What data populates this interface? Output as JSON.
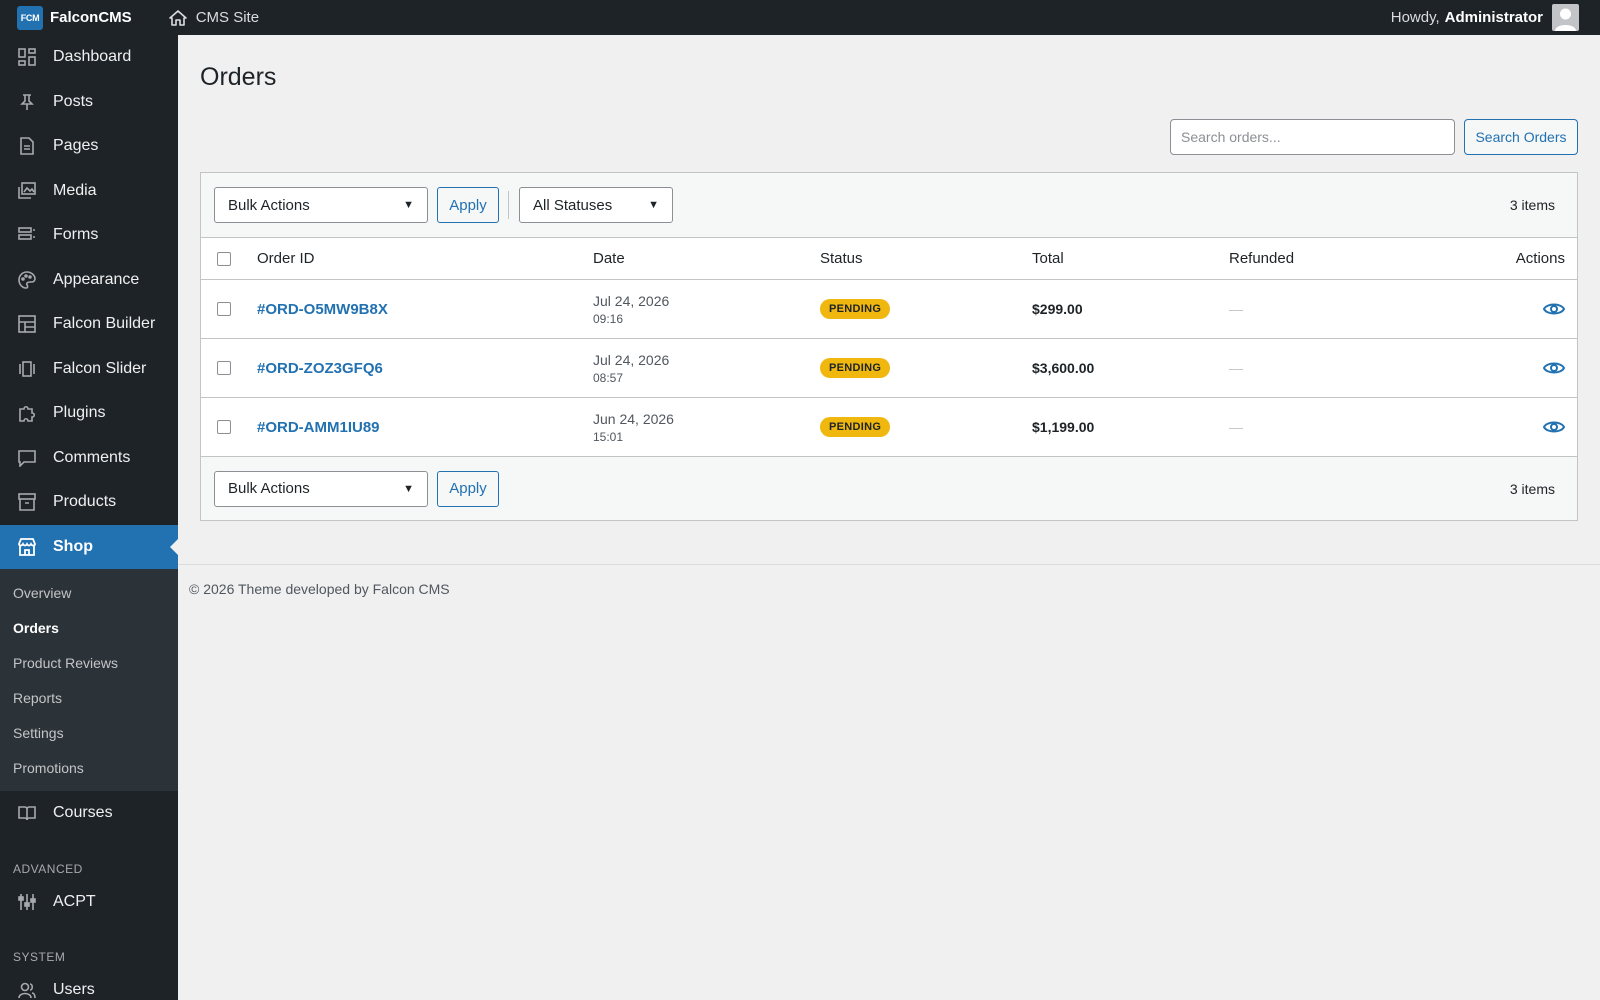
{
  "adminbar": {
    "logo_text": "FCM",
    "brand": "FalconCMS",
    "site_label": "CMS Site",
    "greeting": "Howdy,",
    "user": "Administrator"
  },
  "sidebar": {
    "items": [
      {
        "label": "Dashboard",
        "icon": "dashboard-icon"
      },
      {
        "label": "Posts",
        "icon": "pin-icon"
      },
      {
        "label": "Pages",
        "icon": "page-icon"
      },
      {
        "label": "Media",
        "icon": "media-icon"
      },
      {
        "label": "Forms",
        "icon": "forms-icon"
      },
      {
        "label": "Appearance",
        "icon": "palette-icon"
      },
      {
        "label": "Falcon Builder",
        "icon": "layout-icon"
      },
      {
        "label": "Falcon Slider",
        "icon": "slider-icon"
      },
      {
        "label": "Plugins",
        "icon": "plugin-icon"
      },
      {
        "label": "Comments",
        "icon": "comment-icon"
      },
      {
        "label": "Products",
        "icon": "archive-icon"
      },
      {
        "label": "Shop",
        "icon": "store-icon"
      }
    ],
    "shop_sub": [
      "Overview",
      "Orders",
      "Product Reviews",
      "Reports",
      "Settings",
      "Promotions"
    ],
    "courses": "Courses",
    "section_advanced": "ADVANCED",
    "acpt": "ACPT",
    "section_system": "SYSTEM",
    "users": "Users"
  },
  "main": {
    "title": "Orders",
    "search_placeholder": "Search orders...",
    "search_button": "Search Orders",
    "bulk_actions": "Bulk Actions",
    "apply": "Apply",
    "status_filter": "All Statuses",
    "items_count": "3 items",
    "columns": [
      "Order ID",
      "Date",
      "Status",
      "Total",
      "Refunded",
      "Actions"
    ],
    "rows": [
      {
        "id": "#ORD-O5MW9B8X",
        "date": "Jul 24, 2026",
        "time": "09:16",
        "status": "PENDING",
        "total": "$299.00",
        "refunded": "—"
      },
      {
        "id": "#ORD-ZOZ3GFQ6",
        "date": "Jul 24, 2026",
        "time": "08:57",
        "status": "PENDING",
        "total": "$3,600.00",
        "refunded": "—"
      },
      {
        "id": "#ORD-AMM1IU89",
        "date": "Jun 24, 2026",
        "time": "15:01",
        "status": "PENDING",
        "total": "$1,199.00",
        "refunded": "—"
      }
    ]
  },
  "footer": "© 2026 Theme developed by Falcon CMS",
  "colors": {
    "accent": "#2271b1",
    "sidebar_bg": "#1d2327",
    "pending": "#f0b70e"
  }
}
